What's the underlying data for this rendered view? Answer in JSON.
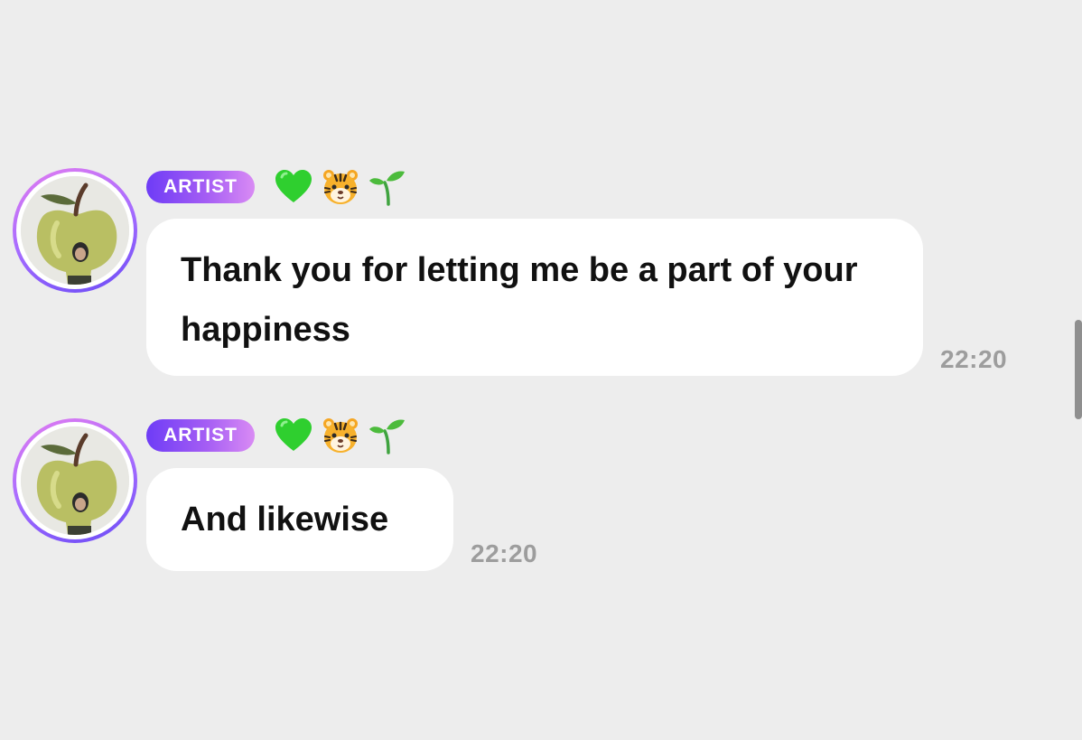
{
  "messages": [
    {
      "role_badge": "ARTIST",
      "emoji_icons": [
        "green-heart-icon",
        "tiger-face-icon",
        "seedling-icon"
      ],
      "text": "Thank you for letting me be a part of your happiness",
      "time": "22:20"
    },
    {
      "role_badge": "ARTIST",
      "emoji_icons": [
        "green-heart-icon",
        "tiger-face-icon",
        "seedling-icon"
      ],
      "text": "And likewise",
      "time": "22:20"
    }
  ],
  "colors": {
    "background": "#ededed",
    "bubble": "#ffffff",
    "badge_gradient": [
      "#6e3cf6",
      "#d98bf4"
    ],
    "timestamp": "#9d9d9d"
  }
}
